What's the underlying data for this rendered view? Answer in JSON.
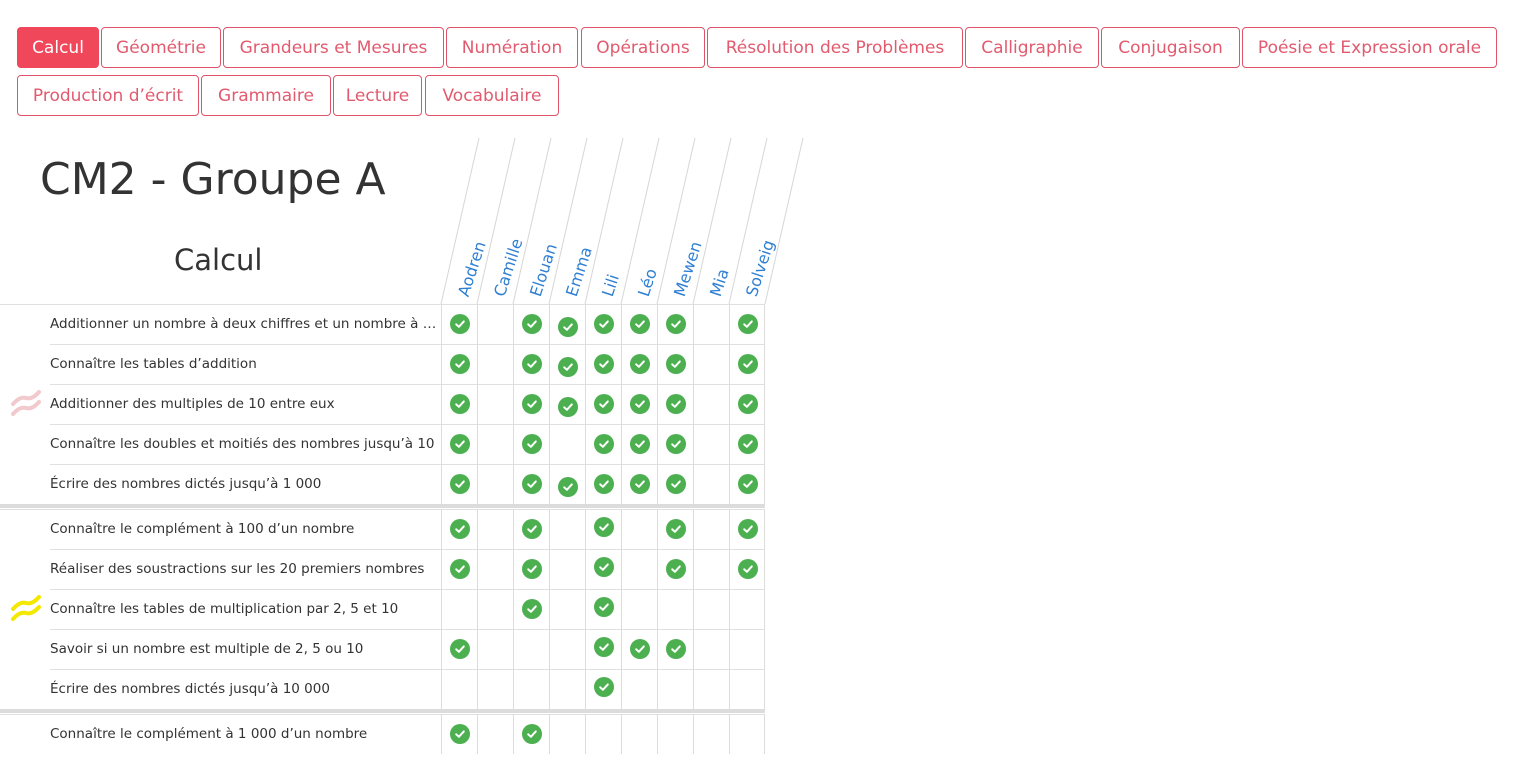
{
  "tabs": [
    {
      "label": "Calcul",
      "active": true
    },
    {
      "label": "Géométrie"
    },
    {
      "label": "Grandeurs et Mesures"
    },
    {
      "label": "Numération"
    },
    {
      "label": "Opérations"
    },
    {
      "label": "Résolution des Problèmes"
    },
    {
      "label": "Calligraphie"
    },
    {
      "label": "Conjugaison"
    },
    {
      "label": "Poésie et Expression orale"
    },
    {
      "label": "Production d’écrit"
    },
    {
      "label": "Grammaire"
    },
    {
      "label": "Lecture"
    },
    {
      "label": "Vocabulaire"
    }
  ],
  "page": {
    "title": "CM2 - Groupe A",
    "subject": "Calcul"
  },
  "students": [
    "Aodren",
    "Camille",
    "Elouan",
    "Emma",
    "Lili",
    "Léo",
    "Mewen",
    "Mia",
    "Solveig"
  ],
  "skills": [
    {
      "label": "Additionner un nombre à deux chiffres et un nombre à u…",
      "checks": [
        1,
        0,
        1,
        1,
        1,
        1,
        1,
        0,
        1
      ],
      "mark": "none"
    },
    {
      "label": "Connaître les tables d’addition",
      "checks": [
        1,
        0,
        1,
        1,
        1,
        1,
        1,
        0,
        1
      ],
      "mark": "none"
    },
    {
      "label": "Additionner des multiples de 10 entre eux",
      "checks": [
        1,
        0,
        1,
        1,
        1,
        1,
        1,
        0,
        1
      ],
      "mark": "pink-stripes"
    },
    {
      "label": "Connaître les doubles et moitiés des nombres jusqu’à 10",
      "checks": [
        1,
        0,
        1,
        0,
        1,
        1,
        1,
        0,
        1
      ],
      "mark": "none"
    },
    {
      "label": "Écrire des nombres dictés jusqu’à 1 000",
      "checks": [
        1,
        0,
        1,
        1,
        1,
        1,
        1,
        0,
        1
      ],
      "mark": "none"
    },
    {
      "label": "Connaître le complément à 100 d’un nombre",
      "checks": [
        1,
        0,
        1,
        0,
        1,
        0,
        1,
        0,
        1
      ],
      "mark": "none",
      "group_start": true
    },
    {
      "label": "Réaliser des soustractions sur les 20 premiers nombres",
      "checks": [
        1,
        0,
        1,
        0,
        1,
        0,
        1,
        0,
        1
      ],
      "mark": "none"
    },
    {
      "label": "Connaître les tables de multiplication par 2, 5 et 10",
      "checks": [
        0,
        0,
        1,
        0,
        1,
        0,
        0,
        0,
        0
      ],
      "mark": "yellow-stripes"
    },
    {
      "label": "Savoir si un nombre est multiple de 2, 5 ou 10",
      "checks": [
        1,
        0,
        0,
        0,
        1,
        1,
        1,
        0,
        0
      ],
      "mark": "none"
    },
    {
      "label": "Écrire des nombres dictés jusqu’à 10 000",
      "checks": [
        0,
        0,
        0,
        0,
        1,
        0,
        0,
        0,
        0
      ],
      "mark": "none"
    },
    {
      "label": "Connaître le complément à 1 000 d’un nombre",
      "checks": [
        1,
        0,
        1,
        0,
        0,
        0,
        0,
        0,
        0
      ],
      "mark": "none",
      "group_start": true
    }
  ],
  "colors": {
    "accent": "#f0475b",
    "tab_text": "#e25a6e",
    "student": "#2f7fd3",
    "check": "#4caf50",
    "pink_mark": "#f2c9cd",
    "yellow_mark": "#f5e800"
  },
  "icons": {
    "check": "check-circle-icon"
  }
}
